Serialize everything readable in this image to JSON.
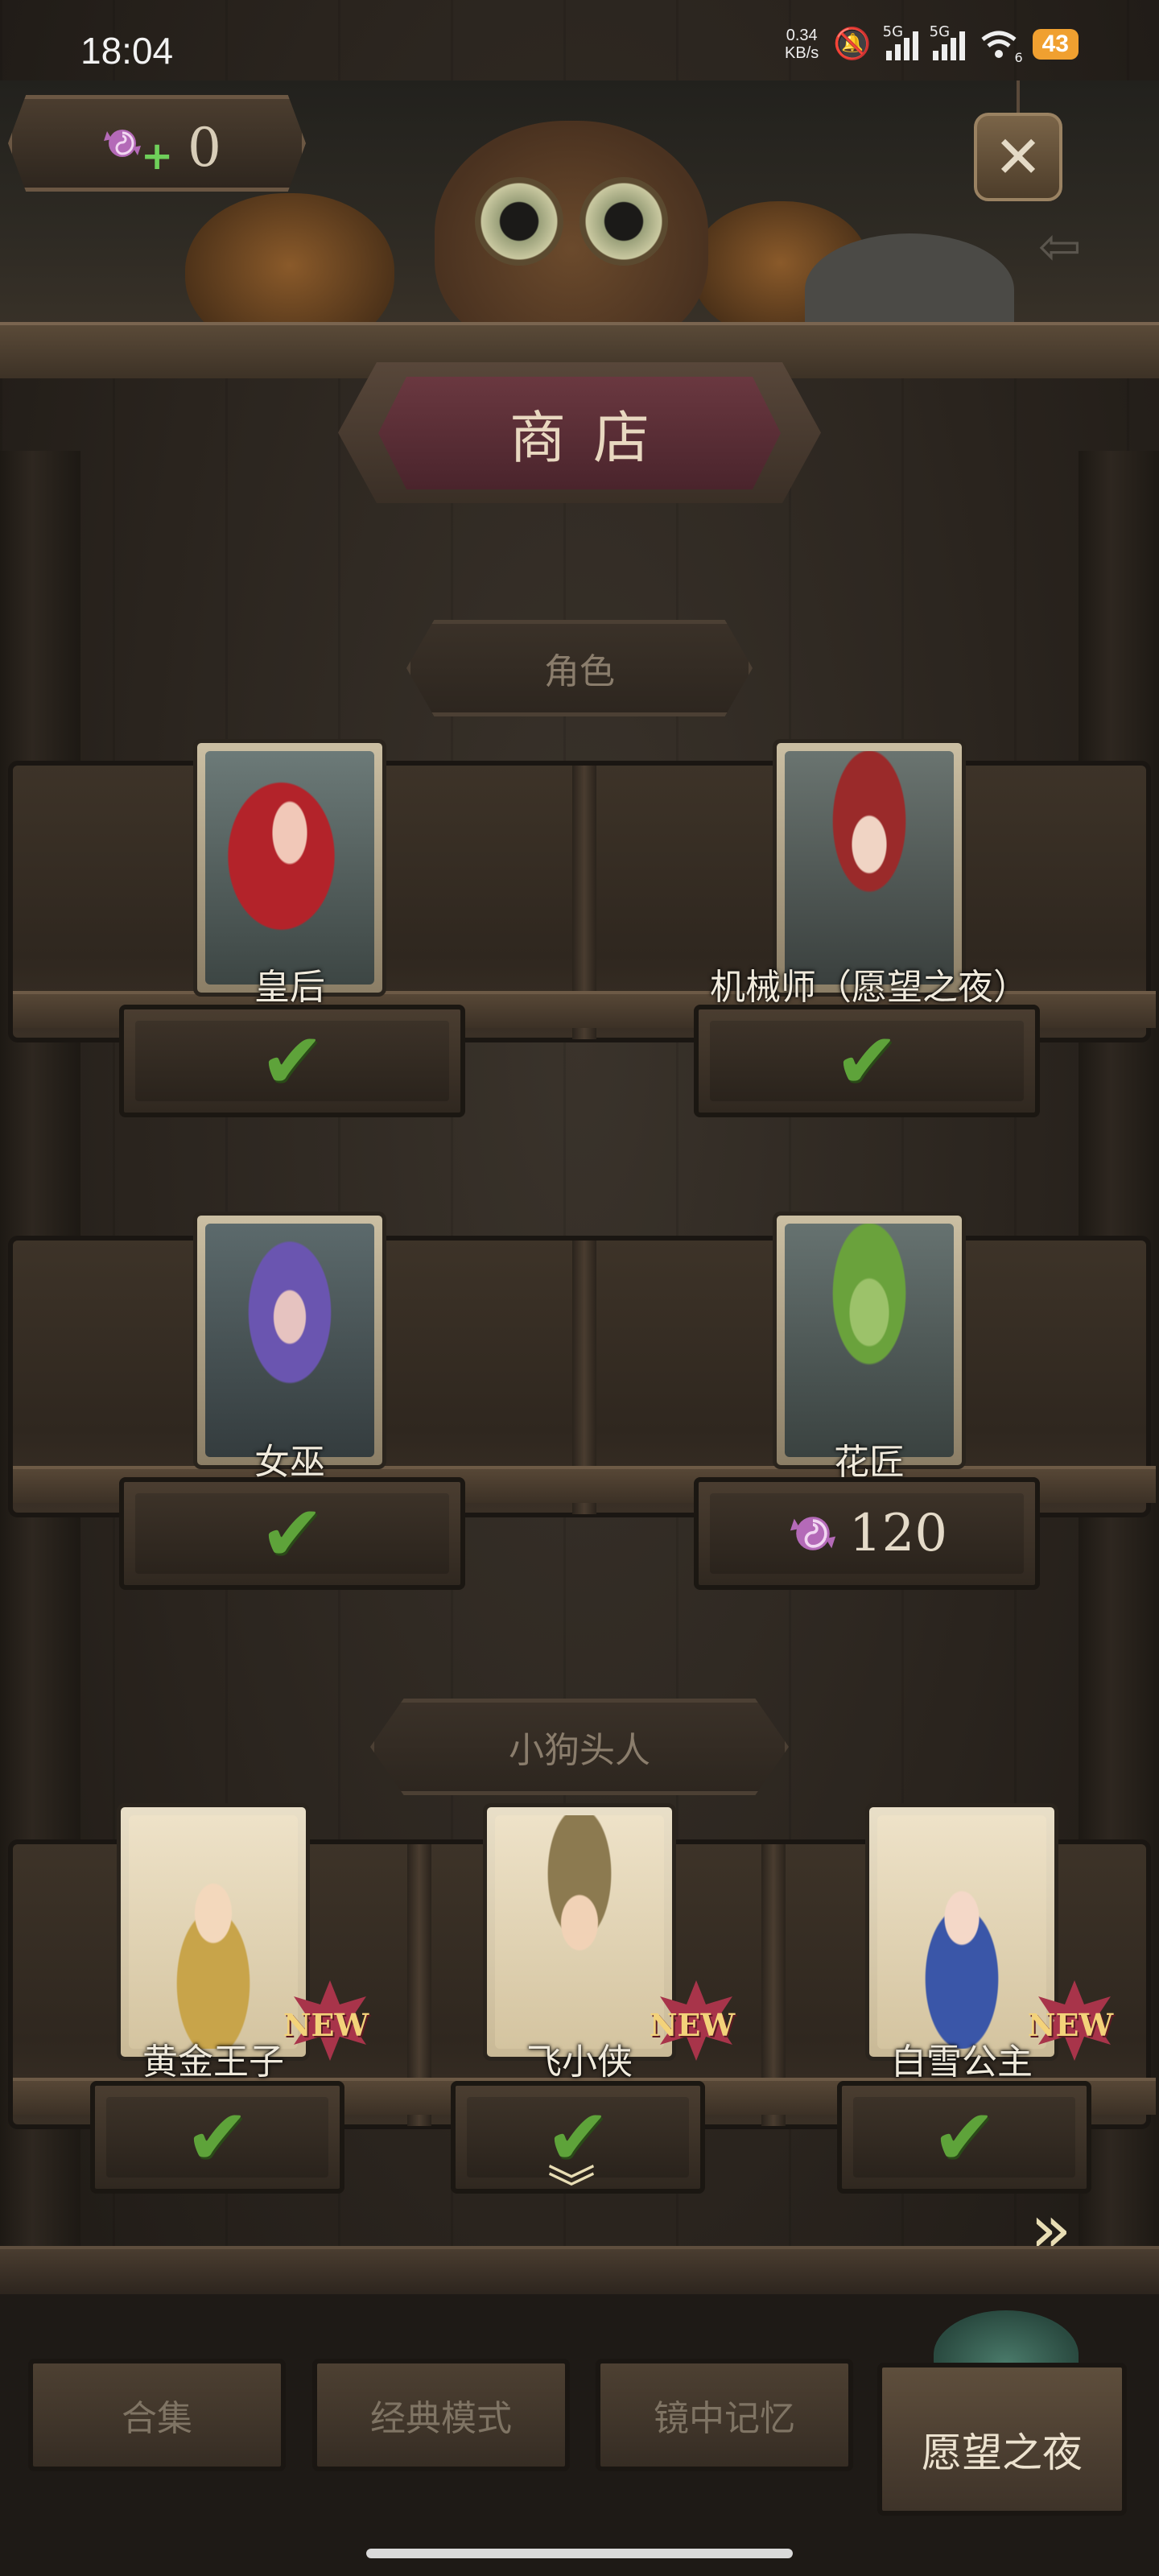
{
  "status_bar": {
    "time": "18:04",
    "net_speed_value": "0.34",
    "net_speed_unit": "KB/s",
    "signal1_label": "5G",
    "signal2_label": "5G",
    "wifi_label": "6",
    "battery": "43"
  },
  "header": {
    "currency_value": "0",
    "close_glyph": "✕",
    "title": "商店"
  },
  "sections": {
    "characters_title": "角色",
    "dogheads_title": "小狗头人"
  },
  "characters": [
    {
      "name": "皇后",
      "status": "owned"
    },
    {
      "name": "机械师（愿望之夜）",
      "status": "owned"
    },
    {
      "name": "女巫",
      "status": "owned"
    },
    {
      "name": "花匠",
      "status": "price",
      "price": "120"
    }
  ],
  "dogheads": [
    {
      "name": "黄金王子",
      "badge": "NEW",
      "status": "owned"
    },
    {
      "name": "飞小侠",
      "badge": "NEW",
      "status": "owned"
    },
    {
      "name": "白雪公主",
      "badge": "NEW",
      "status": "owned"
    }
  ],
  "owned_glyph": "✔",
  "tabs": [
    {
      "label": "合集",
      "active": false
    },
    {
      "label": "经典模式",
      "active": false
    },
    {
      "label": "镜中记忆",
      "active": false
    },
    {
      "label": "愿望之夜",
      "active": true
    }
  ],
  "icons": {
    "currency": "candy-icon",
    "scroll": "chevron-double-down-icon",
    "next": "chevron-double-right-icon"
  },
  "colors": {
    "check_green": "#5ea33a",
    "new_badge": "#a8344a",
    "candy_purple": "#b46ab8"
  }
}
